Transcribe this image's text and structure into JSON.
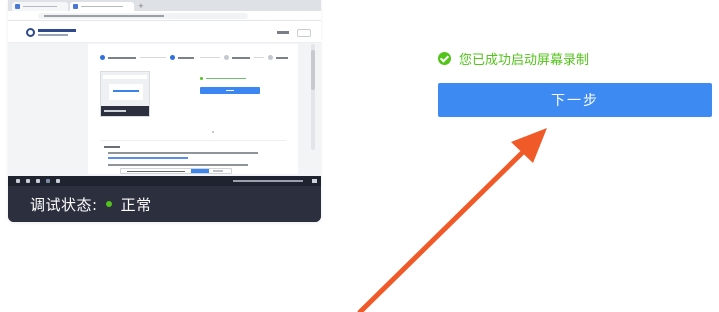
{
  "preview": {
    "debug_label": "调试状态:",
    "debug_status": "正常",
    "status_color": "#52c41a"
  },
  "main": {
    "success_message": "您已成功启动屏幕录制",
    "next_button_label": "下一步",
    "accent_color": "#3d8bf2"
  },
  "annotation": {
    "arrow_color": "#f05a28",
    "icon": "red-arrow-icon"
  }
}
